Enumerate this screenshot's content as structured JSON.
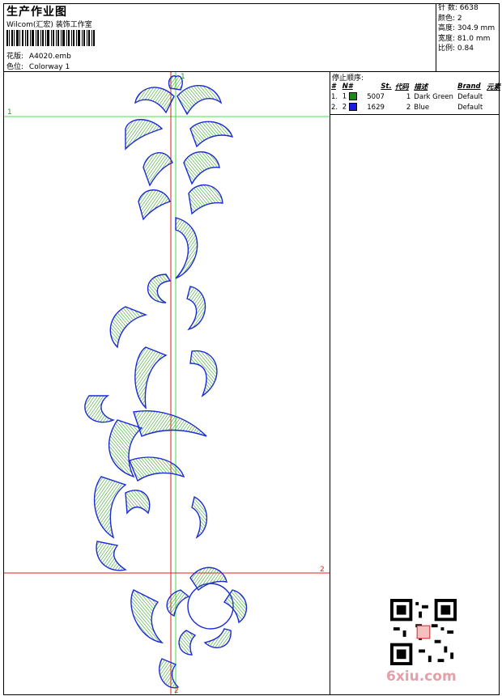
{
  "header": {
    "title": "生产作业图",
    "company": "Wilcom(汇宏) 装饰工作室",
    "design_label": "花版:",
    "design_value": "A4020.emb",
    "colorway_label": "色位:",
    "colorway_value": "Colorway 1"
  },
  "stats": {
    "stitches_label": "针 数:",
    "stitches_value": "6638",
    "colors_label": "颜色:",
    "colors_value": "2",
    "height_label": "高度:",
    "height_value": "304.9 mm",
    "width_label": "宽度:",
    "width_value": "81.0 mm",
    "scale_label": "比例:",
    "scale_value": "0.84"
  },
  "stop_sequence": {
    "heading": "停止顺序:",
    "columns": [
      "#",
      "N#",
      "St.",
      "代码",
      "描述",
      "Brand",
      "元素"
    ],
    "rows": [
      {
        "index": "1.",
        "needle": "1",
        "color": "#1a8a1a",
        "stitch": "5007",
        "code": "1",
        "description": "Dark Green",
        "brand": "Default",
        "element": ""
      },
      {
        "index": "2.",
        "needle": "2",
        "color": "#1a1ae0",
        "stitch": "1629",
        "code": "2",
        "description": "Blue",
        "brand": "Default",
        "element": ""
      }
    ]
  },
  "canvas": {
    "marker_1": "1",
    "marker_2": "2",
    "top_marker": "1",
    "bottom_marker": "2"
  },
  "watermark": {
    "site": "6xiu.com"
  },
  "colors": {
    "green": "#2a9a1a",
    "blue": "#1a2ad8",
    "guide_green": "#44dd44",
    "guide_red": "#dd2222"
  }
}
